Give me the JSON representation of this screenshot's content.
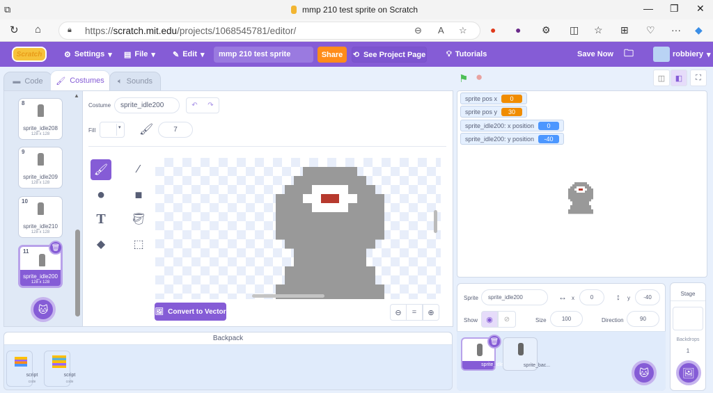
{
  "browser": {
    "tab_title": "mmp 210 test sprite on Scratch",
    "url_prefix": "https://",
    "url_host": "scratch.mit.edu",
    "url_path": "/projects/1068545781/editor/"
  },
  "menu": {
    "logo": "Scratch",
    "settings": "Settings",
    "file": "File",
    "edit": "Edit",
    "project_title": "mmp 210 test sprite",
    "share": "Share",
    "see_project_page": "See Project Page",
    "tutorials": "Tutorials",
    "save_now": "Save Now",
    "username": "robbiery"
  },
  "tabs": [
    {
      "label": "Code",
      "active": false
    },
    {
      "label": "Costumes",
      "active": true
    },
    {
      "label": "Sounds",
      "active": false
    }
  ],
  "costumes": [
    {
      "num": "8",
      "name": "sprite_idle208",
      "size": "128 x 128"
    },
    {
      "num": "9",
      "name": "sprite_idle209",
      "size": "128 x 128"
    },
    {
      "num": "10",
      "name": "sprite_idle210",
      "size": "128 x 128"
    },
    {
      "num": "11",
      "name": "sprite_idle200",
      "size": "128 x 128",
      "selected": true
    }
  ],
  "paint_editor": {
    "costume_label": "Costume",
    "costume_name": "sprite_idle200",
    "fill_label": "Fill",
    "brush_size": "7",
    "convert_button": "Convert to Vector",
    "zoom_out": "−",
    "zoom_reset": "=",
    "zoom_in": "+",
    "active_tool": "brush"
  },
  "colors": {
    "accent": "#855cd6",
    "share": "#ff8c1a",
    "sprite_gray": "#999999",
    "sprite_eye": "#b73a2e",
    "var_orange": "#f08c00",
    "motion_blue": "#4c97ff"
  },
  "backpack": {
    "title": "Backpack",
    "items": [
      {
        "name": "script",
        "type": "code"
      },
      {
        "name": "script",
        "type": "code"
      }
    ]
  },
  "monitors": [
    {
      "label": "sprite pos x",
      "value": "0",
      "kind": "variable"
    },
    {
      "label": "sprite pos y",
      "value": "30",
      "kind": "variable"
    },
    {
      "label": "sprite_idle200: x position",
      "value": "0",
      "kind": "motion"
    },
    {
      "label": "sprite_idle200: y position",
      "value": "-40",
      "kind": "motion"
    }
  ],
  "sprite_info": {
    "sprite_label": "Sprite",
    "sprite_name": "sprite_idle200",
    "x_label": "x",
    "x": "0",
    "y_label": "y",
    "y": "-40",
    "show_label": "Show",
    "size_label": "Size",
    "size": "100",
    "direction_label": "Direction",
    "direction": "90"
  },
  "sprites": [
    {
      "name": "sprite_idle...",
      "selected": true
    },
    {
      "name": "sprite_bac...",
      "selected": false
    }
  ],
  "stage_panel": {
    "title": "Stage",
    "backdrops_label": "Backdrops",
    "backdrops_count": "1"
  }
}
